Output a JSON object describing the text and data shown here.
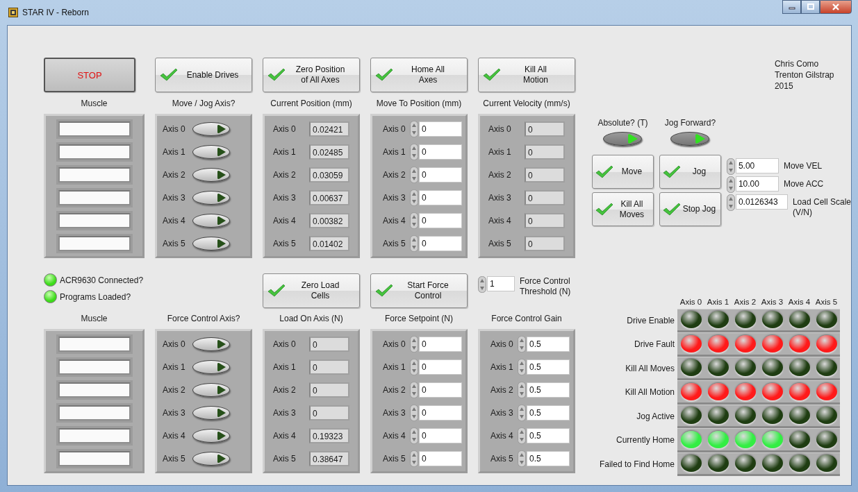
{
  "window": {
    "title": "STAR IV - Reborn"
  },
  "authors": [
    "Chris Como",
    "Trenton Gilstrap",
    "2015"
  ],
  "top": {
    "buttons": [
      {
        "label": "STOP",
        "kind": "stop"
      },
      {
        "label": "Enable Drives",
        "kind": "check"
      },
      {
        "label": "Zero Position\nof All Axes",
        "kind": "check"
      },
      {
        "label": "Home All\nAxes",
        "kind": "check"
      },
      {
        "label": "Kill All\nMotion",
        "kind": "check"
      }
    ],
    "columns": [
      {
        "label": "Muscle",
        "kind": "string",
        "rows": [
          {},
          {},
          {},
          {},
          {},
          {}
        ]
      },
      {
        "label": "Move / Jog Axis?",
        "kind": "toggle",
        "rows": [
          {
            "label": "Axis 0",
            "on": false
          },
          {
            "label": "Axis 1",
            "on": false
          },
          {
            "label": "Axis 2",
            "on": false
          },
          {
            "label": "Axis 3",
            "on": false
          },
          {
            "label": "Axis 4",
            "on": false
          },
          {
            "label": "Axis 5",
            "on": false
          }
        ]
      },
      {
        "label": "Current Position (mm)",
        "kind": "indicator",
        "rows": [
          {
            "label": "Axis 0",
            "value": "0.02421"
          },
          {
            "label": "Axis 1",
            "value": "0.02485"
          },
          {
            "label": "Axis 2",
            "value": "0.03059"
          },
          {
            "label": "Axis 3",
            "value": "0.00637"
          },
          {
            "label": "Axis 4",
            "value": "0.00382"
          },
          {
            "label": "Axis 5",
            "value": "0.01402"
          }
        ]
      },
      {
        "label": "Move To Position (mm)",
        "kind": "control",
        "rows": [
          {
            "label": "Axis 0",
            "value": "0"
          },
          {
            "label": "Axis 1",
            "value": "0"
          },
          {
            "label": "Axis 2",
            "value": "0"
          },
          {
            "label": "Axis 3",
            "value": "0"
          },
          {
            "label": "Axis 4",
            "value": "0"
          },
          {
            "label": "Axis 5",
            "value": "0"
          }
        ]
      },
      {
        "label": "Current Velocity (mm/s)",
        "kind": "indicator",
        "rows": [
          {
            "label": "Axis 0",
            "value": "0"
          },
          {
            "label": "Axis 1",
            "value": "0"
          },
          {
            "label": "Axis 2",
            "value": "0"
          },
          {
            "label": "Axis 3",
            "value": "0"
          },
          {
            "label": "Axis 4",
            "value": "0"
          },
          {
            "label": "Axis 5",
            "value": "0"
          }
        ]
      }
    ]
  },
  "status": [
    {
      "label": "ACR9630 Connected?",
      "on": true
    },
    {
      "label": "Programs Loaded?",
      "on": true
    }
  ],
  "bottom": {
    "buttons": [
      {
        "label": "Zero Load\nCells",
        "kind": "check"
      },
      {
        "label": "Start Force\nControl",
        "kind": "check"
      }
    ],
    "threshold": {
      "label": "Force Control\nThreshold (N)",
      "value": "1"
    },
    "columns": [
      {
        "label": "Muscle",
        "kind": "string",
        "rows": [
          {},
          {},
          {},
          {},
          {},
          {}
        ]
      },
      {
        "label": "Force Control Axis?",
        "kind": "toggle",
        "rows": [
          {
            "label": "Axis 0",
            "on": false
          },
          {
            "label": "Axis 1",
            "on": false
          },
          {
            "label": "Axis 2",
            "on": false
          },
          {
            "label": "Axis 3",
            "on": false
          },
          {
            "label": "Axis 4",
            "on": false
          },
          {
            "label": "Axis 5",
            "on": false
          }
        ]
      },
      {
        "label": "Load On Axis (N)",
        "kind": "indicator",
        "rows": [
          {
            "label": "Axis 0",
            "value": "0"
          },
          {
            "label": "Axis 1",
            "value": "0"
          },
          {
            "label": "Axis 2",
            "value": "0"
          },
          {
            "label": "Axis 3",
            "value": "0"
          },
          {
            "label": "Axis 4",
            "value": "0.19323"
          },
          {
            "label": "Axis 5",
            "value": "0.38647"
          }
        ]
      },
      {
        "label": "Force Setpoint (N)",
        "kind": "control",
        "rows": [
          {
            "label": "Axis 0",
            "value": "0"
          },
          {
            "label": "Axis 1",
            "value": "0"
          },
          {
            "label": "Axis 2",
            "value": "0"
          },
          {
            "label": "Axis 3",
            "value": "0"
          },
          {
            "label": "Axis 4",
            "value": "0"
          },
          {
            "label": "Axis 5",
            "value": "0"
          }
        ]
      },
      {
        "label": "Force Control Gain",
        "kind": "control",
        "rows": [
          {
            "label": "Axis 0",
            "value": "0.5"
          },
          {
            "label": "Axis 1",
            "value": "0.5"
          },
          {
            "label": "Axis 2",
            "value": "0.5"
          },
          {
            "label": "Axis 3",
            "value": "0.5"
          },
          {
            "label": "Axis 4",
            "value": "0.5"
          },
          {
            "label": "Axis 5",
            "value": "0.5"
          }
        ]
      }
    ]
  },
  "motion": {
    "toggles": [
      {
        "label": "Absolute? (T)",
        "on": true
      },
      {
        "label": "Jog Forward?",
        "on": true
      }
    ],
    "buttons": [
      {
        "label": "Move",
        "kind": "check"
      },
      {
        "label": "Jog",
        "kind": "check"
      },
      {
        "label": "Kill All\nMoves",
        "kind": "check"
      },
      {
        "label": "Stop Jog",
        "kind": "check"
      }
    ],
    "settings": [
      {
        "label": "Move VEL",
        "value": "5.00"
      },
      {
        "label": "Move ACC",
        "value": "10.00"
      },
      {
        "label": "Load Cell Scale\n(V/N)",
        "value": "0.0126343"
      }
    ]
  },
  "status_matrix": {
    "columns": [
      "Axis 0",
      "Axis 1",
      "Axis 2",
      "Axis 3",
      "Axis 4",
      "Axis 5"
    ],
    "rows": [
      {
        "label": "Drive Enable",
        "leds": [
          {
            "on": false
          },
          {
            "on": false
          },
          {
            "on": false
          },
          {
            "on": false
          },
          {
            "on": false
          },
          {
            "on": false
          }
        ]
      },
      {
        "label": "Drive Fault",
        "color": "#ff1a1a",
        "leds": [
          {
            "on": true
          },
          {
            "on": true
          },
          {
            "on": true
          },
          {
            "on": true
          },
          {
            "on": true
          },
          {
            "on": true
          }
        ]
      },
      {
        "label": "Kill All Moves",
        "leds": [
          {
            "on": false
          },
          {
            "on": false
          },
          {
            "on": false
          },
          {
            "on": false
          },
          {
            "on": false
          },
          {
            "on": false
          }
        ]
      },
      {
        "label": "Kill All Motion",
        "color": "#ff1a1a",
        "leds": [
          {
            "on": true
          },
          {
            "on": true
          },
          {
            "on": true
          },
          {
            "on": true
          },
          {
            "on": true
          },
          {
            "on": true
          }
        ]
      },
      {
        "label": "Jog Active",
        "leds": [
          {
            "on": false
          },
          {
            "on": false
          },
          {
            "on": false
          },
          {
            "on": false
          },
          {
            "on": false
          },
          {
            "on": false
          }
        ]
      },
      {
        "label": "Currently Home",
        "color": "#33ee44",
        "leds": [
          {
            "on": true
          },
          {
            "on": true
          },
          {
            "on": true
          },
          {
            "on": true
          },
          {
            "on": false
          },
          {
            "on": false
          }
        ]
      },
      {
        "label": "Failed to Find Home",
        "leds": [
          {
            "on": false
          },
          {
            "on": false
          },
          {
            "on": false
          },
          {
            "on": false
          },
          {
            "on": false
          },
          {
            "on": false
          }
        ]
      }
    ]
  }
}
